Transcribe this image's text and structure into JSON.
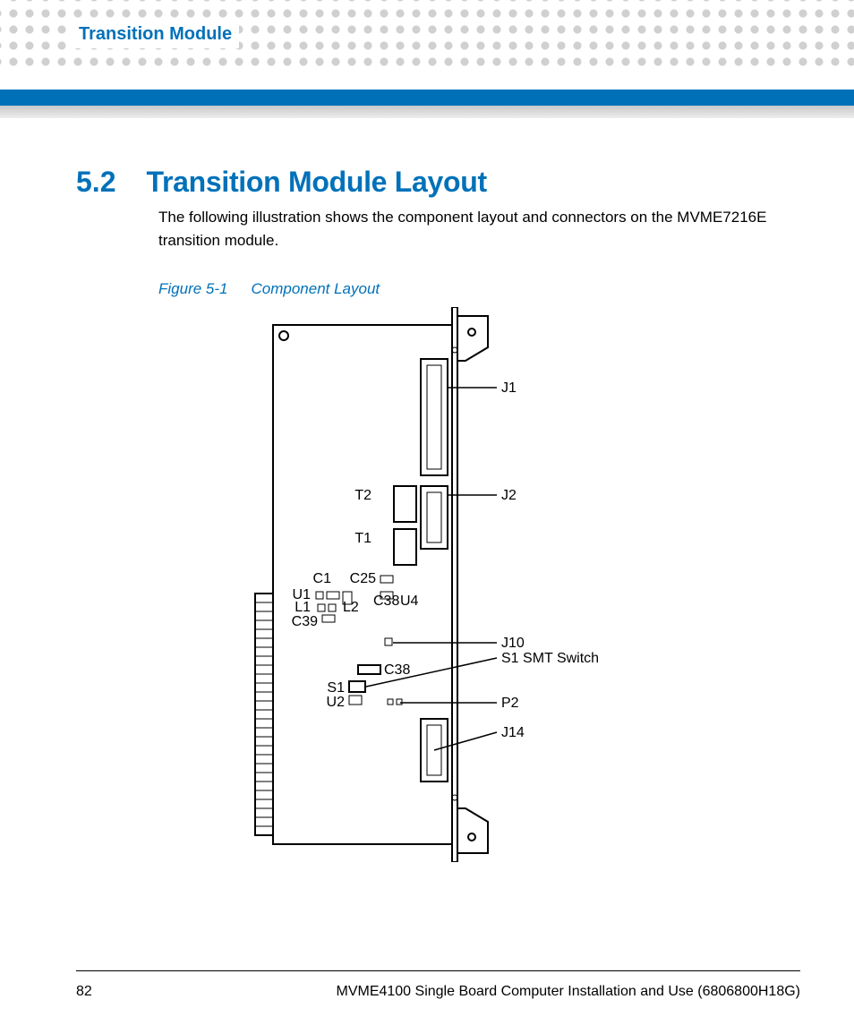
{
  "header": {
    "chapter_title": "Transition Module"
  },
  "section": {
    "number": "5.2",
    "title": "Transition Module Layout",
    "body": "The following illustration shows the component layout and connectors on the MVME7216E transition module."
  },
  "figure": {
    "number": "Figure 5-1",
    "caption": "Component Layout",
    "labels": {
      "j1": "J1",
      "j2": "J2",
      "t2": "T2",
      "t1": "T1",
      "c1": "C1",
      "c25": "C25",
      "u1": "U1",
      "c38a": "C38",
      "u4": "U4",
      "l1": "L1",
      "l2": "L2",
      "c39": "C39",
      "j10": "J10",
      "s1_smt": "S1 SMT Switch",
      "c38b": "C38",
      "s1": "S1",
      "p2": "P2",
      "u2": "U2",
      "j14": "J14"
    }
  },
  "footer": {
    "page_number": "82",
    "doc_title": "MVME4100 Single Board Computer Installation and Use (6806800H18G)"
  }
}
